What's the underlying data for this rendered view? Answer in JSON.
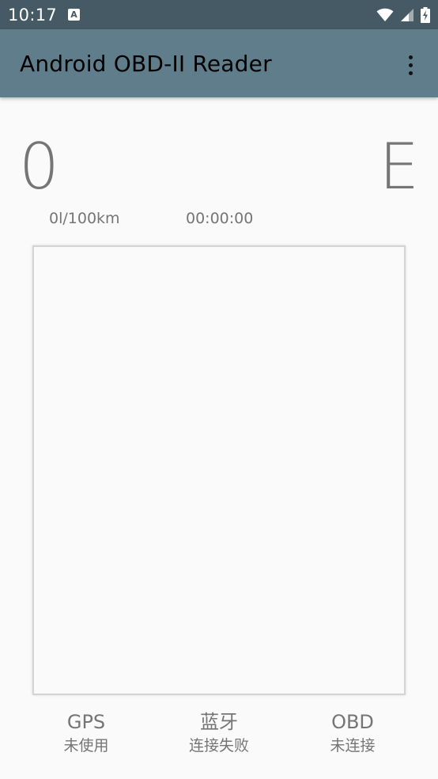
{
  "status_bar": {
    "time": "10:17",
    "notification_icon": "A"
  },
  "app_bar": {
    "title": "Android OBD-II Reader",
    "overflow_icon": "more-vert-icon"
  },
  "dashboard": {
    "speed": "0",
    "gear": "E",
    "fuel_consumption": "0l/100km",
    "trip_time": "00:00:00"
  },
  "status": {
    "gps": {
      "label": "GPS",
      "value": "未使用"
    },
    "bluetooth": {
      "label": "蓝牙",
      "value": "连接失败"
    },
    "obd": {
      "label": "OBD",
      "value": "未连接"
    }
  },
  "colors": {
    "status_bar_bg": "#455a64",
    "app_bar_bg": "#607d8b",
    "background": "#fafafa",
    "text_secondary": "#757575"
  }
}
